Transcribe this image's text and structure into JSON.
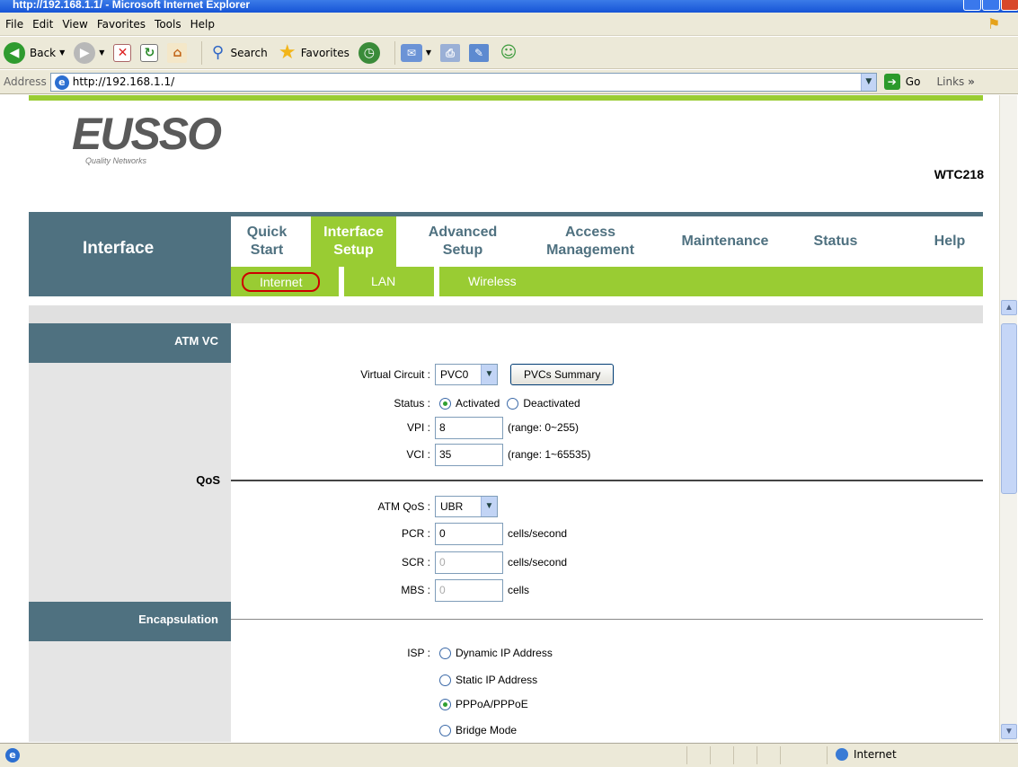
{
  "window": {
    "title": "http://192.168.1.1/ - Microsoft Internet Explorer"
  },
  "menu": [
    "File",
    "Edit",
    "View",
    "Favorites",
    "Tools",
    "Help"
  ],
  "toolbar": {
    "back": "Back",
    "search": "Search",
    "favorites": "Favorites"
  },
  "address": {
    "label": "Address",
    "url": "http://192.168.1.1/",
    "go": "Go",
    "links": "Links"
  },
  "brand": {
    "logo": "EUSSO",
    "tagline": "Quality Networks",
    "model": "WTC218"
  },
  "nav": {
    "section": "Interface",
    "tabs": [
      {
        "line1": "Quick",
        "line2": "Start"
      },
      {
        "line1": "Interface",
        "line2": "Setup"
      },
      {
        "line1": "Advanced",
        "line2": "Setup"
      },
      {
        "line1": "Access",
        "line2": "Management"
      },
      {
        "line1": "Maintenance",
        "line2": ""
      },
      {
        "line1": "Status",
        "line2": ""
      },
      {
        "line1": "Help",
        "line2": ""
      }
    ],
    "subtabs": [
      "Internet",
      "LAN",
      "Wireless"
    ]
  },
  "form": {
    "atm_vc": {
      "heading": "ATM VC",
      "virtual_circuit_label": "Virtual Circuit :",
      "virtual_circuit_value": "PVC0",
      "pvcs_summary": "PVCs Summary",
      "status_label": "Status :",
      "status_activated": "Activated",
      "status_deactivated": "Deactivated",
      "vpi_label": "VPI :",
      "vpi_value": "8",
      "vpi_hint": "(range: 0~255)",
      "vci_label": "VCI :",
      "vci_value": "35",
      "vci_hint": "(range: 1~65535)"
    },
    "qos": {
      "heading": "QoS",
      "atm_qos_label": "ATM QoS :",
      "atm_qos_value": "UBR",
      "pcr_label": "PCR :",
      "pcr_value": "0",
      "scr_label": "SCR :",
      "scr_value": "0",
      "mbs_label": "MBS :",
      "mbs_value": "0",
      "unit_cps": "cells/second",
      "unit_cells": "cells"
    },
    "encapsulation": {
      "heading": "Encapsulation",
      "isp_label": "ISP :",
      "options": [
        "Dynamic IP Address",
        "Static IP Address",
        "PPPoA/PPPoE",
        "Bridge Mode"
      ]
    }
  },
  "statusbar": {
    "zone": "Internet"
  }
}
